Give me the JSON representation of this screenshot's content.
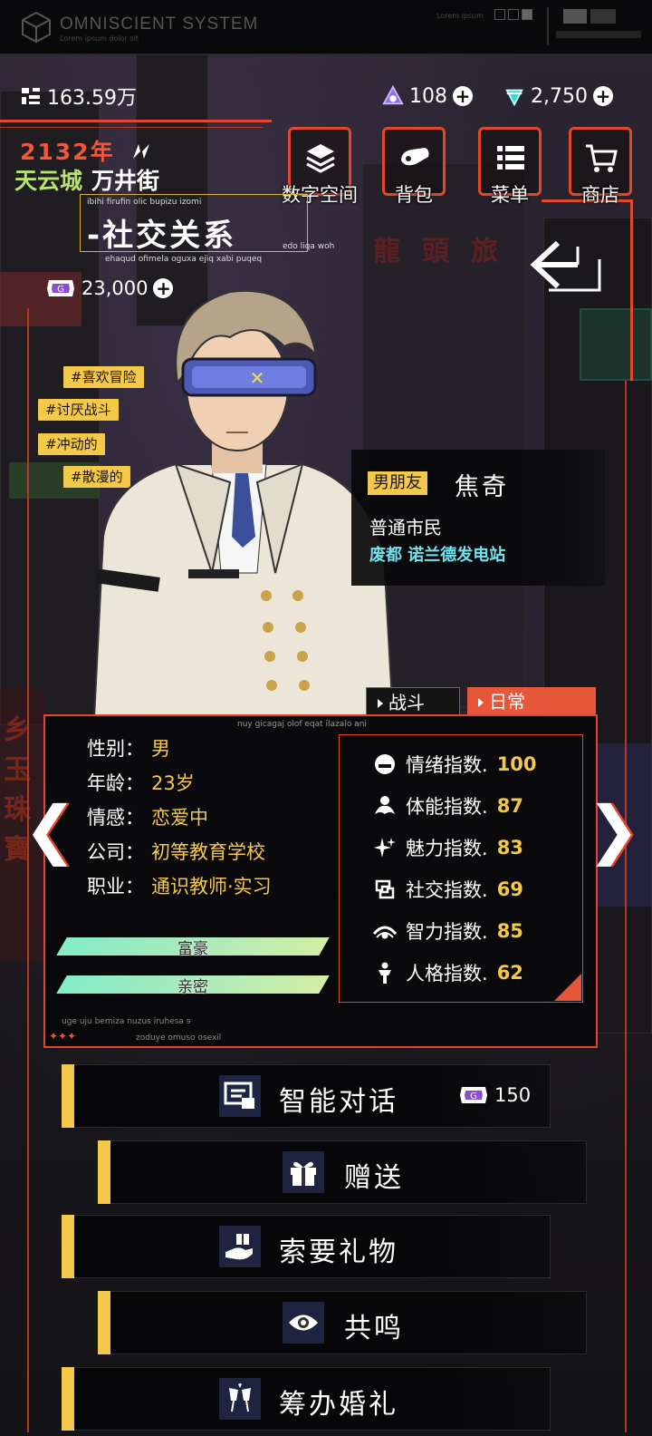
{
  "system": {
    "title": "OMNISCIENT  SYSTEM",
    "subtitle": "Lorem ipsum dolor sit",
    "right_label": "Lorem ipsum"
  },
  "currency": {
    "cash": "163.59万",
    "crystal": "108",
    "diamond": "2,750",
    "plus": "+"
  },
  "time": {
    "year": "2132年"
  },
  "location": {
    "city": "天云城",
    "street": "万井街"
  },
  "nav": [
    {
      "label": "数字空间",
      "icon": "layers-icon"
    },
    {
      "label": "背包",
      "icon": "bag-icon"
    },
    {
      "label": "菜单",
      "icon": "menu-icon"
    },
    {
      "label": "商店",
      "icon": "cart-icon"
    }
  ],
  "page": {
    "title": "-社交关系",
    "small_top": "ibihi firufin olic bupizu izomi",
    "small_bottom": "ehaqud ofimela oguxa ejiq xabi puqeq",
    "small_right": "edo liqa woh",
    "coins": "23,000"
  },
  "tags": [
    "#喜欢冒险",
    "#讨厌战斗",
    "#冲动的",
    "#散漫的"
  ],
  "npc": {
    "relation": "男朋友",
    "name": "焦奇",
    "role": "普通市民",
    "place": "废都 诺兰德发电站"
  },
  "tabs": {
    "battle": "战斗",
    "daily": "日常"
  },
  "panel_noise": {
    "top": "nuy gicagaj olof eqat ilazalo ani",
    "bottom1": "uge uju bemiza nuzus iruhesa s",
    "bottom2": "zoduye omuso osexil",
    "stars": "✦✦✦"
  },
  "attributes": [
    {
      "key": "性别：",
      "value": "男"
    },
    {
      "key": "年龄：",
      "value": "23岁"
    },
    {
      "key": "情感：",
      "value": "恋爱中"
    },
    {
      "key": "公司：",
      "value": "初等教育学校"
    },
    {
      "key": "职业：",
      "value": "通识教师·实习"
    }
  ],
  "bars": [
    {
      "label": "富豪"
    },
    {
      "label": "亲密"
    }
  ],
  "stats": [
    {
      "icon": "mood-icon",
      "label": "情绪指数.",
      "value": "100"
    },
    {
      "icon": "stamina-icon",
      "label": "体能指数.",
      "value": "87"
    },
    {
      "icon": "charm-icon",
      "label": "魅力指数.",
      "value": "83"
    },
    {
      "icon": "social-icon",
      "label": "社交指数.",
      "value": "69"
    },
    {
      "icon": "intellect-icon",
      "label": "智力指数.",
      "value": "85"
    },
    {
      "icon": "personality-icon",
      "label": "人格指数.",
      "value": "62"
    }
  ],
  "arrows": {
    "left": "❮",
    "right": "❯"
  },
  "actions": [
    {
      "label": "智能对话",
      "icon": "chat-icon",
      "cost": "150"
    },
    {
      "label": "赠送",
      "icon": "gift-icon"
    },
    {
      "label": "索要礼物",
      "icon": "request-gift-icon"
    },
    {
      "label": "共鸣",
      "icon": "eye-icon"
    },
    {
      "label": "筹办婚礼",
      "icon": "toast-icon"
    }
  ],
  "colors": {
    "accent": "#e2472a",
    "gold": "#f4c94a",
    "cyan": "#74e2ee",
    "green": "#b5e36d"
  }
}
